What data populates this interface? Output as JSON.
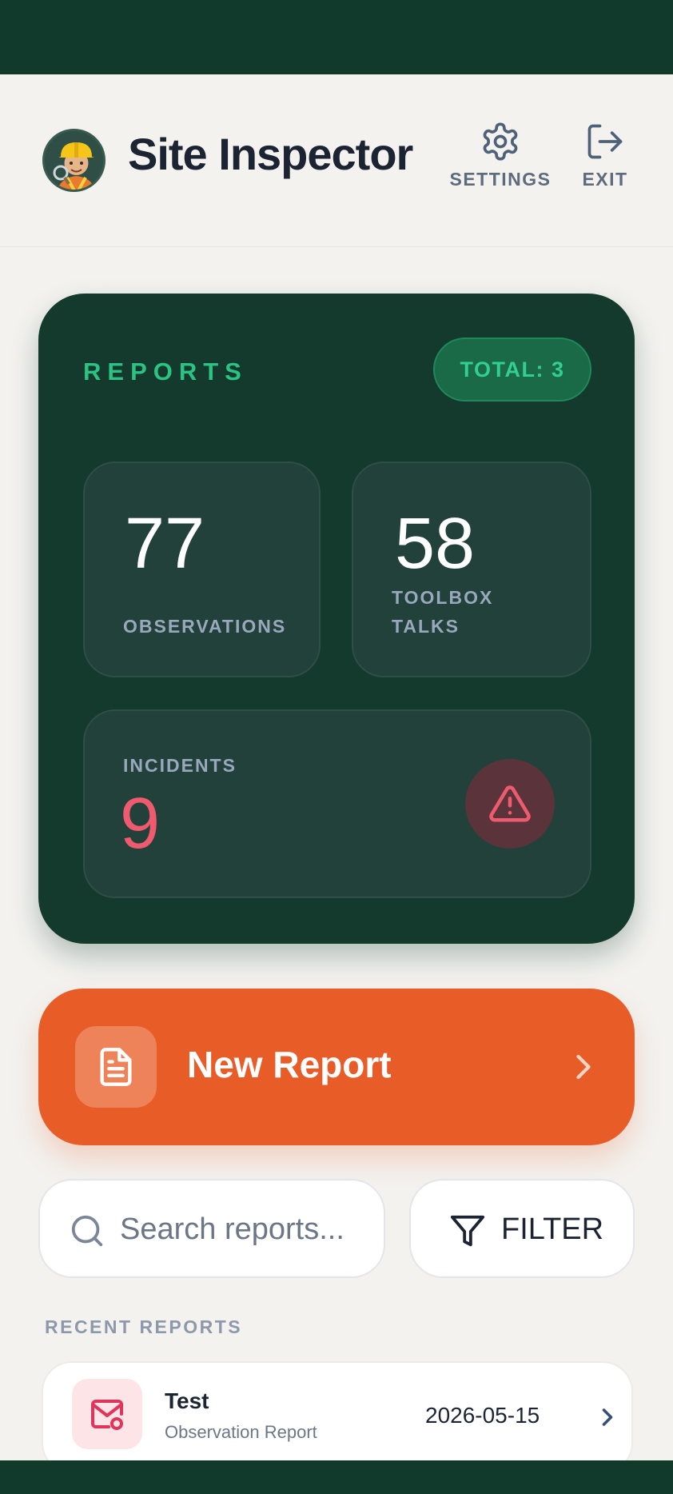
{
  "header": {
    "title": "Site Inspector",
    "settings_label": "SETTINGS",
    "exit_label": "EXIT",
    "avatar_icon": "inspector-avatar"
  },
  "reports": {
    "label": "REPORTS",
    "total": "TOTAL: 3",
    "observations": {
      "value": "77",
      "label": "OBSERVATIONS"
    },
    "toolbox_talks": {
      "value": "58",
      "label": "TOOLBOX TALKS"
    },
    "incidents": {
      "value": "9",
      "label": "INCIDENTS",
      "icon": "warning-triangle-icon"
    }
  },
  "new_report": {
    "label": "New Report",
    "icon": "document-icon"
  },
  "search": {
    "placeholder": "Search reports..."
  },
  "filter": {
    "label": "FILTER"
  },
  "recent": {
    "heading": "RECENT REPORTS",
    "items": [
      {
        "title": "Test",
        "type": "Observation Report",
        "date": "2026-05-15",
        "icon": "mail-alert-icon"
      }
    ]
  },
  "colors": {
    "dark_green": "#133a2c",
    "accent_green": "#2bc283",
    "orange": "#e85c27",
    "danger": "#f05a6e",
    "background": "#f3f2ef"
  }
}
